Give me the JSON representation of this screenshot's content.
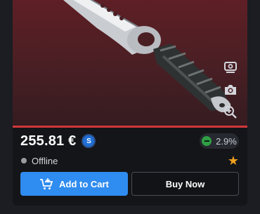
{
  "item": {
    "price": "255.81 €",
    "currency_badge": "S",
    "change": "2.9%",
    "status": "Offline"
  },
  "toolbar": {
    "icons": [
      "view-3d-icon",
      "camera-icon",
      "zoom-in-icon"
    ]
  },
  "actions": {
    "add_to_cart": "Add to Cart",
    "buy_now": "Buy Now"
  },
  "colors": {
    "accent": "#2f8cf0",
    "rarity_line": "#d0383b",
    "change_indicator": "#2f9e45",
    "favorite_star": "#f0a020"
  }
}
